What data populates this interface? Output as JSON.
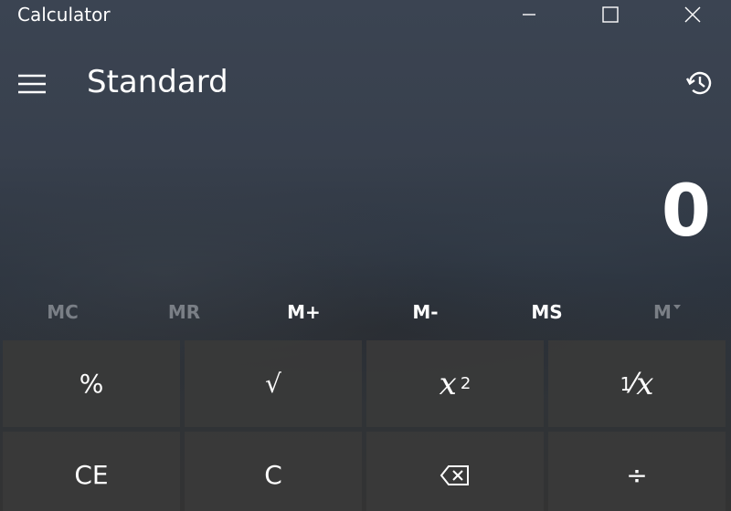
{
  "window": {
    "title": "Calculator",
    "minimize_icon": "minimize-icon",
    "maximize_icon": "maximize-icon",
    "close_icon": "close-icon"
  },
  "header": {
    "mode": "Standard",
    "menu_icon": "hamburger-menu-icon",
    "history_icon": "history-icon"
  },
  "display": {
    "value": "0"
  },
  "memory": {
    "buttons": [
      {
        "label": "MC",
        "enabled": false
      },
      {
        "label": "MR",
        "enabled": false
      },
      {
        "label": "M+",
        "enabled": true
      },
      {
        "label": "M-",
        "enabled": true
      },
      {
        "label": "MS",
        "enabled": true
      },
      {
        "label": "M",
        "enabled": false
      }
    ]
  },
  "keys": {
    "percent": "%",
    "sqrt": "√",
    "square_base": "x",
    "square_exp": "2",
    "reciprocal_num": "1",
    "reciprocal_den": "x",
    "clear_entry": "CE",
    "clear": "C",
    "backspace_icon": "backspace-icon",
    "divide": "÷"
  },
  "colors": {
    "key_bg": "#3a3a3a",
    "disabled_text": "#7a7f86",
    "text": "#ffffff"
  }
}
